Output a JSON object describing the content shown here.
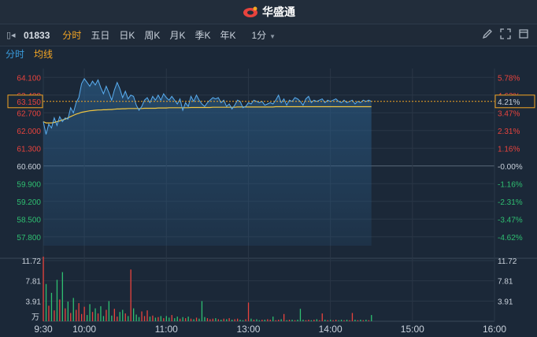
{
  "app": {
    "brand": "华盛通"
  },
  "toolbar": {
    "code": "01833",
    "tabs": [
      "分时",
      "五日",
      "日K",
      "周K",
      "月K",
      "季K",
      "年K"
    ],
    "active_tab": "分时",
    "period": "1分"
  },
  "legend": {
    "line": "分时",
    "avg": "均线"
  },
  "colors": {
    "up": "#e8433d",
    "down": "#2fbf71",
    "price_line": "#5aaef0",
    "avg_line": "#f0c541",
    "accent": "#f5a623"
  },
  "current": {
    "price": "63.150",
    "pct": "4.21%"
  },
  "axes": {
    "price_ticks": [
      "64.100",
      "63.400",
      "62.700",
      "62.000",
      "61.300",
      "60.600",
      "59.900",
      "59.200",
      "58.500",
      "57.800"
    ],
    "pct_ticks": [
      "5.78%",
      "4.62%",
      "3.47%",
      "2.31%",
      "1.16%",
      "-0.00%",
      "-1.16%",
      "-2.31%",
      "-3.47%",
      "-4.62%"
    ],
    "volume_ticks": [
      "11.72",
      "7.81",
      "3.91"
    ],
    "volume_unit": "万",
    "time_ticks": [
      "9:30",
      "10:00",
      "11:00",
      "13:00",
      "14:00",
      "15:00",
      "16:00"
    ]
  },
  "chart_data": {
    "type": "line",
    "x_minutes_from_open": [
      0,
      2,
      4,
      6,
      8,
      10,
      12,
      14,
      16,
      18,
      20,
      22,
      24,
      26,
      28,
      30,
      32,
      34,
      36,
      38,
      40,
      42,
      44,
      46,
      48,
      50,
      52,
      54,
      56,
      58,
      60,
      62,
      64,
      66,
      68,
      70,
      72,
      74,
      76,
      78,
      80,
      82,
      84,
      86,
      88,
      90,
      92,
      94,
      96,
      98,
      100,
      102,
      104,
      106,
      108,
      110,
      112,
      114,
      116,
      118,
      120,
      122,
      124,
      126,
      128,
      130,
      132,
      134,
      136,
      138,
      140,
      142,
      144,
      146,
      148,
      150,
      152,
      154,
      156,
      158,
      160,
      162,
      164,
      166,
      168,
      170,
      172,
      174,
      176,
      178,
      180,
      182,
      184,
      186,
      188,
      190,
      192,
      194,
      196,
      198,
      200,
      202,
      204,
      206,
      208,
      210,
      212,
      214,
      216,
      218,
      220,
      222,
      224,
      226,
      228,
      230,
      232,
      234,
      236,
      238,
      240
    ],
    "series": [
      {
        "name": "分时",
        "values": [
          62.35,
          61.85,
          62.25,
          62.1,
          62.5,
          62.2,
          62.55,
          62.35,
          62.5,
          62.45,
          62.9,
          62.7,
          63.1,
          63.3,
          63.85,
          64.05,
          63.9,
          63.75,
          63.95,
          63.8,
          64.0,
          63.7,
          63.45,
          63.75,
          63.5,
          63.2,
          63.6,
          63.9,
          63.65,
          63.3,
          63.55,
          63.25,
          63.4,
          63.35,
          63.0,
          62.8,
          62.95,
          63.2,
          63.3,
          63.1,
          63.35,
          63.2,
          63.4,
          63.2,
          63.45,
          63.3,
          63.2,
          63.35,
          63.2,
          63.05,
          63.25,
          62.8,
          63.1,
          62.95,
          63.35,
          63.15,
          63.4,
          63.2,
          63.05,
          62.95,
          63.1,
          63.2,
          63.3,
          63.25,
          63.3,
          63.1,
          63.2,
          62.95,
          63.05,
          62.85,
          63.0,
          63.2,
          63.15,
          62.9,
          62.95,
          63.1,
          63.05,
          63.2,
          63.15,
          63.1,
          63.15,
          63.0,
          63.05,
          63.1,
          63.05,
          63.2,
          63.4,
          63.1,
          63.25,
          63.0,
          63.2,
          63.15,
          63.3,
          63.25,
          63.15,
          63.0,
          63.25,
          63.35,
          63.1,
          63.2,
          63.15,
          63.2,
          63.25,
          63.1,
          63.2,
          63.15,
          63.2,
          63.25,
          63.15,
          63.1,
          63.2,
          63.1,
          63.15,
          63.2,
          63.05,
          63.15,
          63.1,
          63.2,
          63.15,
          63.2,
          63.15
        ]
      },
      {
        "name": "均线",
        "values": [
          62.35,
          62.3,
          62.3,
          62.3,
          62.32,
          62.35,
          62.38,
          62.42,
          62.45,
          62.5,
          62.55,
          62.6,
          62.65,
          62.68,
          62.72,
          62.74,
          62.76,
          62.78,
          62.79,
          62.8,
          62.81,
          62.81,
          62.82,
          62.82,
          62.83,
          62.83,
          62.84,
          62.85,
          62.85,
          62.86,
          62.86,
          62.87,
          62.87,
          62.87,
          62.87,
          62.87,
          62.87,
          62.88,
          62.88,
          62.88,
          62.88,
          62.88,
          62.89,
          62.89,
          62.89,
          62.89,
          62.9,
          62.9,
          62.9,
          62.9,
          62.9,
          62.9,
          62.9,
          62.9,
          62.91,
          62.91,
          62.91,
          62.91,
          62.91,
          62.91,
          62.91,
          62.91,
          62.92,
          62.92,
          62.92,
          62.92,
          62.92,
          62.92,
          62.92,
          62.92,
          62.92,
          62.93,
          62.93,
          62.93,
          62.93,
          62.93,
          62.93,
          62.93,
          62.93,
          62.93,
          62.93,
          62.93,
          62.93,
          62.93,
          62.93,
          62.94,
          62.94,
          62.94,
          62.94,
          62.94,
          62.94,
          62.94,
          62.94,
          62.94,
          62.94,
          62.94,
          62.94,
          62.94,
          62.94,
          62.94,
          62.94,
          62.94,
          62.94,
          62.94,
          62.94,
          62.94,
          62.94,
          62.94,
          62.94,
          62.94,
          62.94,
          62.94,
          62.94,
          62.94,
          62.94,
          62.94,
          62.94,
          62.94,
          62.94,
          62.94,
          62.94
        ]
      }
    ],
    "volume": [
      12.5,
      7.2,
      3.0,
      5.5,
      2.1,
      8.0,
      4.2,
      9.5,
      2.5,
      3.8,
      1.6,
      4.5,
      2.2,
      3.5,
      1.4,
      2.8,
      1.2,
      3.3,
      1.8,
      2.5,
      1.5,
      2.9,
      1.0,
      2.2,
      3.9,
      1.1,
      2.4,
      0.9,
      1.8,
      2.2,
      1.5,
      1.0,
      10.0,
      2.5,
      1.3,
      0.8,
      1.9,
      1.0,
      2.1,
      0.9,
      1.1,
      0.7,
      0.8,
      1.0,
      0.6,
      1.0,
      0.7,
      1.2,
      0.6,
      0.9,
      0.5,
      0.8,
      0.6,
      0.9,
      0.5,
      0.4,
      0.7,
      0.5,
      3.9,
      0.8,
      0.6,
      0.4,
      0.5,
      0.6,
      0.4,
      0.3,
      0.5,
      0.4,
      0.6,
      0.3,
      0.4,
      0.5,
      0.3,
      0.2,
      0.4,
      3.6,
      0.5,
      0.3,
      0.4,
      0.2,
      0.3,
      0.3,
      0.4,
      0.3,
      0.9,
      0.2,
      0.3,
      0.4,
      1.4,
      0.2,
      0.3,
      0.3,
      0.2,
      0.3,
      2.4,
      0.3,
      0.2,
      0.3,
      0.2,
      0.3,
      0.4,
      0.2,
      1.5,
      0.3,
      0.2,
      0.3,
      0.2,
      0.3,
      0.2,
      0.3,
      0.2,
      0.3,
      0.2,
      1.6,
      0.3,
      0.2,
      0.3,
      0.2,
      0.3,
      0.2,
      1.2
    ],
    "prev_close": 60.6,
    "ylim": [
      57.45,
      64.45
    ],
    "volume_max": 11.72
  }
}
